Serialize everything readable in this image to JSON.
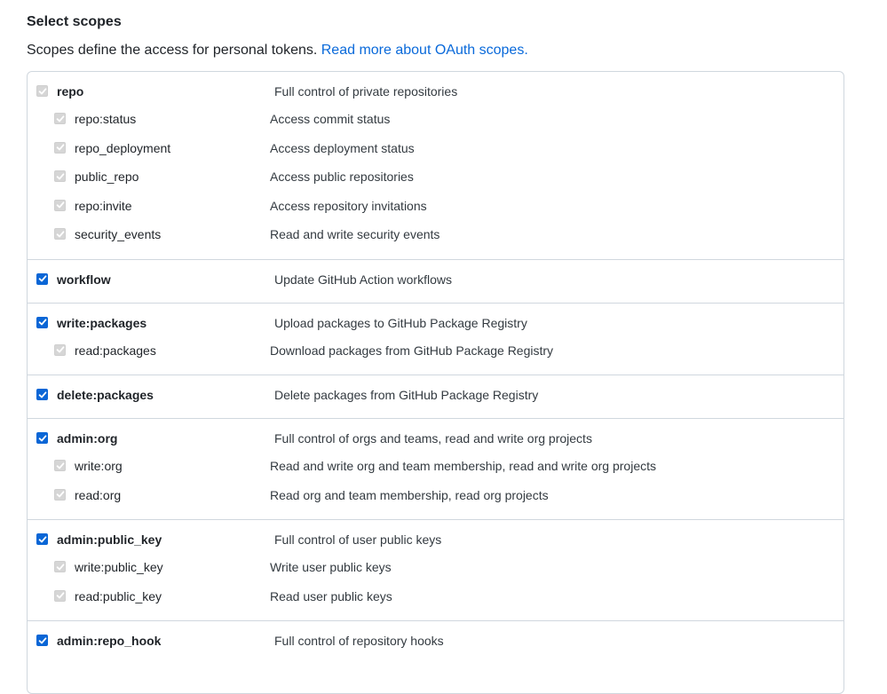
{
  "header": {
    "title": "Select scopes",
    "intro_text": "Scopes define the access for personal tokens. ",
    "intro_link": "Read more about OAuth scopes."
  },
  "colors": {
    "checkbox_checked": "#0a66d6",
    "checkbox_disabled": "#d6d6d6",
    "link": "#0969da",
    "border": "#d0d7de"
  },
  "scopes": [
    {
      "name": "repo",
      "description": "Full control of private repositories",
      "checked": true,
      "disabled": true,
      "children": [
        {
          "name": "repo:status",
          "description": "Access commit status"
        },
        {
          "name": "repo_deployment",
          "description": "Access deployment status"
        },
        {
          "name": "public_repo",
          "description": "Access public repositories"
        },
        {
          "name": "repo:invite",
          "description": "Access repository invitations"
        },
        {
          "name": "security_events",
          "description": "Read and write security events"
        }
      ]
    },
    {
      "name": "workflow",
      "description": "Update GitHub Action workflows",
      "checked": true,
      "disabled": false,
      "children": []
    },
    {
      "name": "write:packages",
      "description": "Upload packages to GitHub Package Registry",
      "checked": true,
      "disabled": false,
      "children": [
        {
          "name": "read:packages",
          "description": "Download packages from GitHub Package Registry"
        }
      ]
    },
    {
      "name": "delete:packages",
      "description": "Delete packages from GitHub Package Registry",
      "checked": true,
      "disabled": false,
      "children": []
    },
    {
      "name": "admin:org",
      "description": "Full control of orgs and teams, read and write org projects",
      "checked": true,
      "disabled": false,
      "children": [
        {
          "name": "write:org",
          "description": "Read and write org and team membership, read and write org projects"
        },
        {
          "name": "read:org",
          "description": "Read org and team membership, read org projects"
        }
      ]
    },
    {
      "name": "admin:public_key",
      "description": "Full control of user public keys",
      "checked": true,
      "disabled": false,
      "children": [
        {
          "name": "write:public_key",
          "description": "Write user public keys"
        },
        {
          "name": "read:public_key",
          "description": "Read user public keys"
        }
      ]
    },
    {
      "name": "admin:repo_hook",
      "description": "Full control of repository hooks",
      "checked": true,
      "disabled": false,
      "children": []
    }
  ]
}
